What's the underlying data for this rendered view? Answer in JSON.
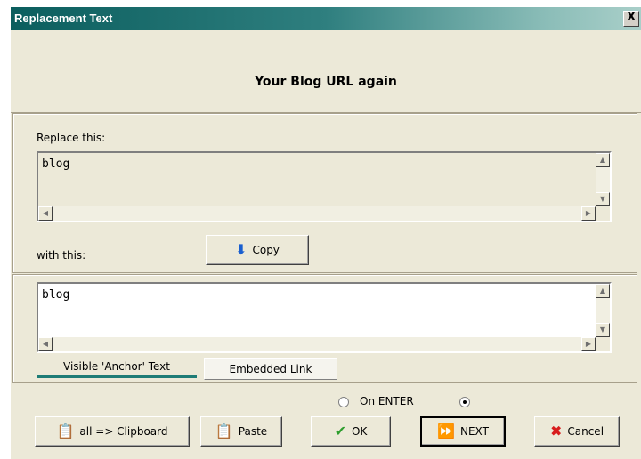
{
  "window": {
    "title": "Replacement Text",
    "close_glyph": "X"
  },
  "header": {
    "title": "Your Blog URL again"
  },
  "replace": {
    "label": "Replace this:",
    "value": "blog"
  },
  "with": {
    "label": "with this:",
    "value": "blog"
  },
  "copy_button": {
    "label": "Copy",
    "icon": "down-arrow-icon",
    "icon_color": "#1a5fd0"
  },
  "tabs": [
    {
      "label": "Visible 'Anchor' Text",
      "active": true
    },
    {
      "label": "Embedded Link",
      "active": false
    }
  ],
  "radio": {
    "on_enter_label": "On ENTER",
    "on_enter_selected": false,
    "second_selected": true
  },
  "buttons": {
    "clipboard": "all => Clipboard",
    "paste": "Paste",
    "ok": "OK",
    "next": "NEXT",
    "cancel": "Cancel"
  },
  "colors": {
    "ok_check": "#2e9e2e",
    "cancel_x": "#d81d1d",
    "next_arrows": "#1a5fd0",
    "accent": "#1e7c76"
  }
}
